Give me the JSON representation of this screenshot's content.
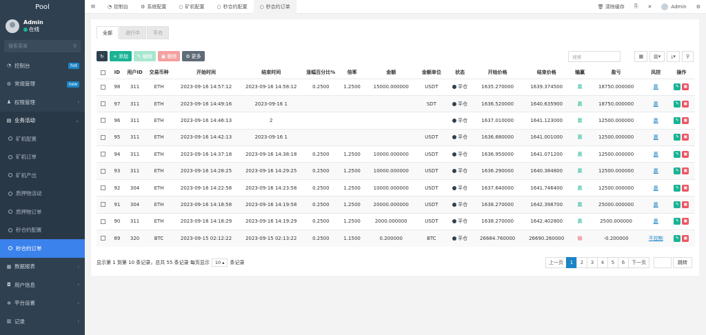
{
  "sidebar": {
    "logo": "Pool",
    "user": {
      "name": "Admin",
      "status": "在线"
    },
    "search_placeholder": "搜索菜单",
    "items": [
      {
        "label": "控制台",
        "badge": "hot"
      },
      {
        "label": "常规管理",
        "badge": "new"
      },
      {
        "label": "权限管理"
      },
      {
        "label": "业务活动"
      }
    ],
    "sub_items": [
      {
        "label": "矿机配置"
      },
      {
        "label": "矿机订单"
      },
      {
        "label": "矿机产出"
      },
      {
        "label": "质押物活动"
      },
      {
        "label": "质押物订单"
      },
      {
        "label": "秒合约配置"
      },
      {
        "label": "秒合约订单"
      }
    ],
    "items_after": [
      {
        "label": "数据报表"
      },
      {
        "label": "用户信息"
      },
      {
        "label": "平台设置"
      },
      {
        "label": "记录"
      }
    ]
  },
  "topbar": {
    "tabs": [
      {
        "label": "控制台"
      },
      {
        "label": "系统配置"
      },
      {
        "label": "矿机配置"
      },
      {
        "label": "秒合约配置"
      },
      {
        "label": "秒合约订单"
      }
    ],
    "clear_cache": "清除缓存",
    "admin": "Admin"
  },
  "status_tabs": [
    "全部",
    "进行中",
    "平仓"
  ],
  "toolbar": {
    "add": "添加",
    "edit": "编辑",
    "delete": "删除",
    "more": "更多"
  },
  "search": {
    "placeholder": "搜索"
  },
  "table": {
    "headers": [
      "ID",
      "用户ID",
      "交易币种",
      "开始时间",
      "结束时间",
      "涨幅百分比%",
      "倍率",
      "金额",
      "金额单位",
      "状态",
      "开始价格",
      "结束价格",
      "输赢",
      "盈亏",
      "风控",
      "操作"
    ],
    "rows": [
      {
        "id": "98",
        "uid": "311",
        "coin": "ETH",
        "start": "2023-09-16 14:57:12",
        "end": "2023-09-16 14:58:12",
        "pct": "0.2500",
        "rate": "1.2500",
        "amount": "15000.000000",
        "unit": "USDT",
        "status": "平仓",
        "sp": "1635.270000",
        "ep": "1639.374500",
        "result": "赢",
        "pnl": "18750.000000",
        "risk": "赢"
      },
      {
        "id": "97",
        "uid": "311",
        "coin": "ETH",
        "start": "2023-09-16 14:49:16",
        "end": "2023-09-16 1",
        "pct": "",
        "rate": "",
        "amount": "",
        "unit": "SDT",
        "status": "平仓",
        "sp": "1636.520000",
        "ep": "1640.635900",
        "result": "赢",
        "pnl": "18750.000000",
        "risk": "赢"
      },
      {
        "id": "96",
        "uid": "311",
        "coin": "ETH",
        "start": "2023-09-16 14:46:13",
        "end": "2",
        "pct": "",
        "rate": "",
        "amount": "",
        "unit": "",
        "status": "平仓",
        "sp": "1637.010000",
        "ep": "1641.123000",
        "result": "赢",
        "pnl": "12500.000000",
        "risk": "赢"
      },
      {
        "id": "95",
        "uid": "311",
        "coin": "ETH",
        "start": "2023-09-16 14:42:13",
        "end": "2023-09-16 1",
        "pct": "",
        "rate": "",
        "amount": "",
        "unit": "USDT",
        "status": "平仓",
        "sp": "1636.680000",
        "ep": "1641.001000",
        "result": "赢",
        "pnl": "12500.000000",
        "risk": "赢"
      },
      {
        "id": "94",
        "uid": "311",
        "coin": "ETH",
        "start": "2023-09-16 14:37:18",
        "end": "2023-09-16 14:38:18",
        "pct": "0.2500",
        "rate": "1.2500",
        "amount": "10000.000000",
        "unit": "USDT",
        "status": "平仓",
        "sp": "1636.950000",
        "ep": "1641.071200",
        "result": "赢",
        "pnl": "12500.000000",
        "risk": "赢"
      },
      {
        "id": "93",
        "uid": "311",
        "coin": "ETH",
        "start": "2023-09-16 14:28:25",
        "end": "2023-09-16 14:29:25",
        "pct": "0.2500",
        "rate": "1.2500",
        "amount": "10000.000000",
        "unit": "USDT",
        "status": "平仓",
        "sp": "1636.290000",
        "ep": "1640.384800",
        "result": "赢",
        "pnl": "12500.000000",
        "risk": "赢"
      },
      {
        "id": "92",
        "uid": "304",
        "coin": "ETH",
        "start": "2023-09-16 14:22:58",
        "end": "2023-09-16 14:23:58",
        "pct": "0.2500",
        "rate": "1.2500",
        "amount": "10000.000000",
        "unit": "USDT",
        "status": "平仓",
        "sp": "1637.640000",
        "ep": "1641.746400",
        "result": "赢",
        "pnl": "12500.000000",
        "risk": "赢"
      },
      {
        "id": "91",
        "uid": "304",
        "coin": "ETH",
        "start": "2023-09-16 14:18:58",
        "end": "2023-09-16 14:19:58",
        "pct": "0.2500",
        "rate": "1.2500",
        "amount": "20000.000000",
        "unit": "USDT",
        "status": "平仓",
        "sp": "1638.270000",
        "ep": "1642.398700",
        "result": "赢",
        "pnl": "25000.000000",
        "risk": "赢"
      },
      {
        "id": "90",
        "uid": "311",
        "coin": "ETH",
        "start": "2023-09-16 14:18:29",
        "end": "2023-09-16 14:19:29",
        "pct": "0.2500",
        "rate": "1.2500",
        "amount": "2000.000000",
        "unit": "USDT",
        "status": "平仓",
        "sp": "1638.270000",
        "ep": "1642.402800",
        "result": "赢",
        "pnl": "2500.000000",
        "risk": "赢"
      },
      {
        "id": "89",
        "uid": "320",
        "coin": "BTC",
        "start": "2023-09-15 02:12:22",
        "end": "2023-09-15 02:13:22",
        "pct": "0.2500",
        "rate": "1.1500",
        "amount": "0.200000",
        "unit": "BTC",
        "status": "平仓",
        "sp": "26684.760000",
        "ep": "26690.260000",
        "result": "输",
        "pnl": "-0.200000",
        "risk": "不控制"
      }
    ]
  },
  "footer": {
    "summary_prefix": "显示第 1 到第 10 条记录，总共 55 条记录 每页显示",
    "page_size": "10",
    "summary_suffix": "条记录"
  },
  "pager": {
    "prev": "上一页",
    "pages": [
      "1",
      "2",
      "3",
      "4",
      "5",
      "6"
    ],
    "next": "下一页",
    "jump": "跳转"
  },
  "colors": {
    "sidebar": "#2f4050",
    "primary": "#1ab394",
    "danger": "#ed5565",
    "active": "#3b82ec"
  }
}
